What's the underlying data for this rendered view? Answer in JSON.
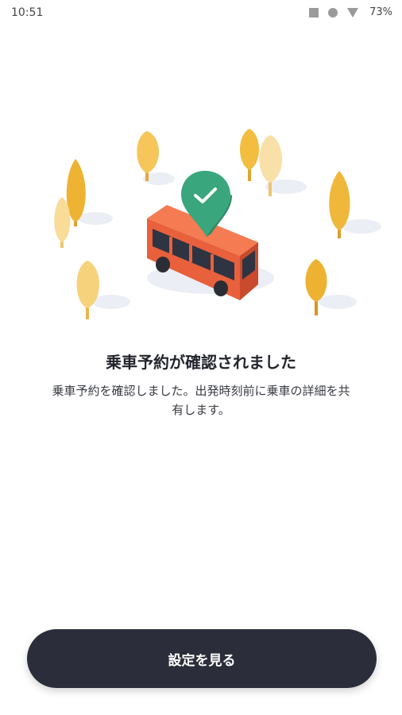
{
  "status_bar": {
    "time": "10:51",
    "battery": "73%"
  },
  "confirmation": {
    "title": "乗車予約が確認されました",
    "description": "乗車予約を確認しました。出発時刻前に乗車の詳細を共有します。"
  },
  "actions": {
    "primary_label": "設定を見る"
  },
  "colors": {
    "button_bg": "#2b2e3a",
    "bus_red": "#e8603c",
    "pin_green": "#3aa67e",
    "tree_yellow": "#f2bd45"
  }
}
